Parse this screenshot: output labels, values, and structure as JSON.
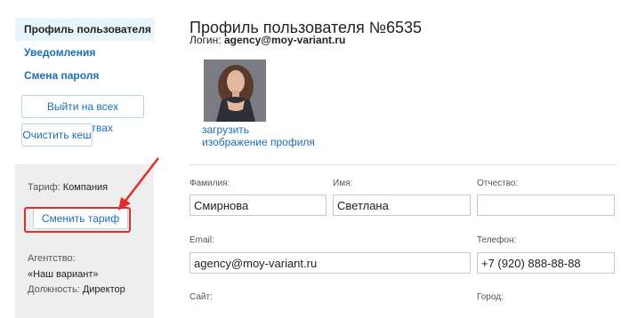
{
  "sidebar": {
    "items": [
      {
        "label": "Профиль пользователя"
      },
      {
        "label": "Уведомления"
      },
      {
        "label": "Смена пароля"
      }
    ],
    "logout_all_label": "Выйти на всех устройствах",
    "clear_cache_label": "Очистить кеш"
  },
  "tariff": {
    "label": "Тариф:",
    "value": "Компания",
    "change_label": "Сменить тариф",
    "agency_label": "Агентство:",
    "agency_value": "«Наш вариант»",
    "position_label": "Должность:",
    "position_value": "Директор"
  },
  "profile": {
    "title": "Профиль пользователя №6535",
    "login_label": "Логин:",
    "login_value": "agency@moy-variant.ru",
    "upload_line1": "загрузить",
    "upload_line2": "изображение профиля"
  },
  "form": {
    "surname_label": "Фамилия:",
    "surname_value": "Смирнова",
    "name_label": "Имя:",
    "name_value": "Светлана",
    "patronymic_label": "Отчество:",
    "patronymic_value": "",
    "email_label": "Email:",
    "email_value": "agency@moy-variant.ru",
    "phone_label": "Телефон:",
    "phone_value": "+7 (920) 888-88-88",
    "site_label": "Сайт:",
    "city_label": "Город:"
  },
  "colors": {
    "link": "#1b6fb5",
    "annotation": "#e32b2b",
    "active_bg": "#e6f4fb"
  }
}
